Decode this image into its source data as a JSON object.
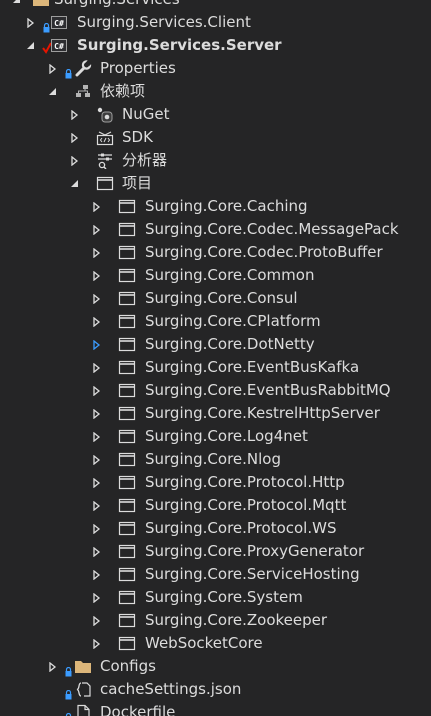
{
  "colors": {
    "background": "#252526",
    "text": "#dcdcdc",
    "lock": "#3b9cff",
    "check": "#e51400",
    "folder": "#dcb67a",
    "nuget": "#004880"
  },
  "solution_folder": {
    "label": "Surging.Services",
    "icon": "folder-icon"
  },
  "projects": [
    {
      "label": "Surging.Services.Client",
      "icon": "csharp-project-icon",
      "expanded": false,
      "locked": true
    },
    {
      "label": "Surging.Services.Server",
      "icon": "csharp-project-icon",
      "expanded": true,
      "locked": true,
      "checked_out": true
    }
  ],
  "server": {
    "properties": {
      "label": "Properties",
      "icon": "wrench-icon"
    },
    "dependencies": {
      "label": "依赖项",
      "icon": "dependencies-icon",
      "nuget": {
        "label": "NuGet",
        "icon": "nuget-icon"
      },
      "sdk": {
        "label": "SDK",
        "icon": "sdk-icon"
      },
      "analyzers": {
        "label": "分析器",
        "icon": "analyzer-icon"
      },
      "projects": {
        "label": "项目",
        "icon": "project-ref-icon",
        "items": [
          "Surging.Core.Caching",
          "Surging.Core.Codec.MessagePack",
          "Surging.Core.Codec.ProtoBuffer",
          "Surging.Core.Common",
          "Surging.Core.Consul",
          "Surging.Core.CPlatform",
          "Surging.Core.DotNetty",
          "Surging.Core.EventBusKafka",
          "Surging.Core.EventBusRabbitMQ",
          "Surging.Core.KestrelHttpServer",
          "Surging.Core.Log4net",
          "Surging.Core.Nlog",
          "Surging.Core.Protocol.Http",
          "Surging.Core.Protocol.Mqtt",
          "Surging.Core.Protocol.WS",
          "Surging.Core.ProxyGenerator",
          "Surging.Core.ServiceHosting",
          "Surging.Core.System",
          "Surging.Core.Zookeeper",
          "WebSocketCore"
        ]
      }
    },
    "configs": {
      "label": "Configs",
      "icon": "folder-icon"
    },
    "cache_settings": {
      "label": "cacheSettings.json",
      "icon": "json-file-icon"
    },
    "dockerfile": {
      "label": "Dockerfile",
      "icon": "file-icon"
    }
  }
}
